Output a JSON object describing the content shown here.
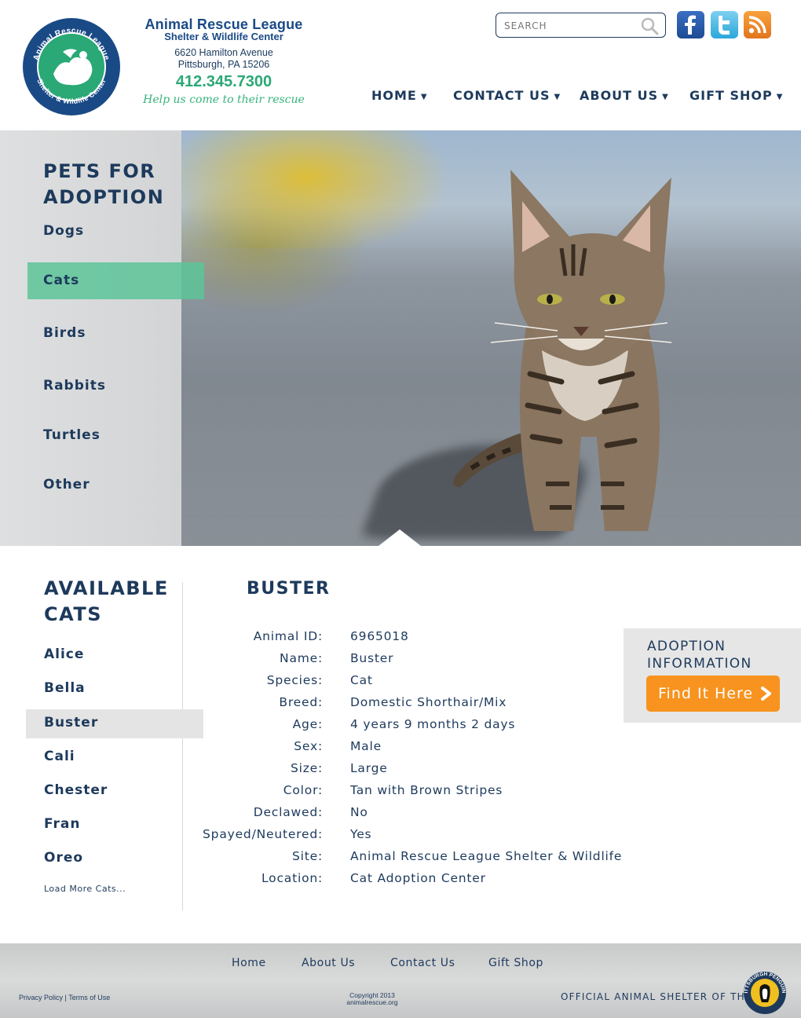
{
  "header": {
    "org_name": "Animal Rescue League",
    "org_subtitle": "Shelter & Wildlife Center",
    "address_line1": "6620 Hamilton Avenue",
    "address_line2": "Pittsburgh, PA 15206",
    "phone": "412.345.7300",
    "tagline": "Help us come to their rescue",
    "logo_text_top": "Animal Rescue League",
    "logo_text_bottom": "Shelter & Wildlife Center",
    "search_placeholder": "SEARCH",
    "social": [
      "facebook-icon",
      "twitter-icon",
      "rss-icon"
    ],
    "nav": [
      {
        "label": "HOME"
      },
      {
        "label": "CONTACT US"
      },
      {
        "label": "ABOUT US"
      },
      {
        "label": "GIFT SHOP"
      }
    ]
  },
  "hero": {
    "title": "PETS FOR ADOPTION",
    "categories": [
      "Dogs",
      "Cats",
      "Birds",
      "Rabbits",
      "Turtles",
      "Other"
    ],
    "active_category": "Cats"
  },
  "available": {
    "title": "AVAILABLE CATS",
    "cats": [
      "Alice",
      "Bella",
      "Buster",
      "Cali",
      "Chester",
      "Fran",
      "Oreo"
    ],
    "active": "Buster",
    "load_more": "Load More Cats..."
  },
  "pet": {
    "name": "BUSTER",
    "details": [
      {
        "label": "Animal ID:",
        "value": "6965018"
      },
      {
        "label": "Name:",
        "value": "Buster"
      },
      {
        "label": "Species:",
        "value": "Cat"
      },
      {
        "label": "Breed:",
        "value": "Domestic Shorthair/Mix"
      },
      {
        "label": "Age:",
        "value": "4 years 9 months 2 days"
      },
      {
        "label": "Sex:",
        "value": "Male"
      },
      {
        "label": "Size:",
        "value": "Large"
      },
      {
        "label": "Color:",
        "value": "Tan with Brown Stripes"
      },
      {
        "label": "Declawed:",
        "value": "No"
      },
      {
        "label": "Spayed/Neutered:",
        "value": "Yes"
      },
      {
        "label": "Site:",
        "value": "Animal Rescue League Shelter & Wildlife"
      },
      {
        "label": "Location:",
        "value": "Cat Adoption Center"
      }
    ]
  },
  "adoption_box": {
    "title": "ADOPTION INFORMATION",
    "button_label": "Find It Here"
  },
  "footer": {
    "nav": [
      "Home",
      "About Us",
      "Contact Us",
      "Gift Shop"
    ],
    "privacy": "Privacy Policy",
    "terms": "Terms of Use",
    "copyright_line1": "Copyright 2013",
    "copyright_line2": "animalrescue.org",
    "official": "OFFICIAL ANIMAL SHELTER OF THE",
    "team_badge": "PITTSBURGH PENGUINS"
  },
  "colors": {
    "navy": "#1d3a5c",
    "green": "#2aa876",
    "active_green": "#5cc498",
    "orange": "#f7931e"
  }
}
